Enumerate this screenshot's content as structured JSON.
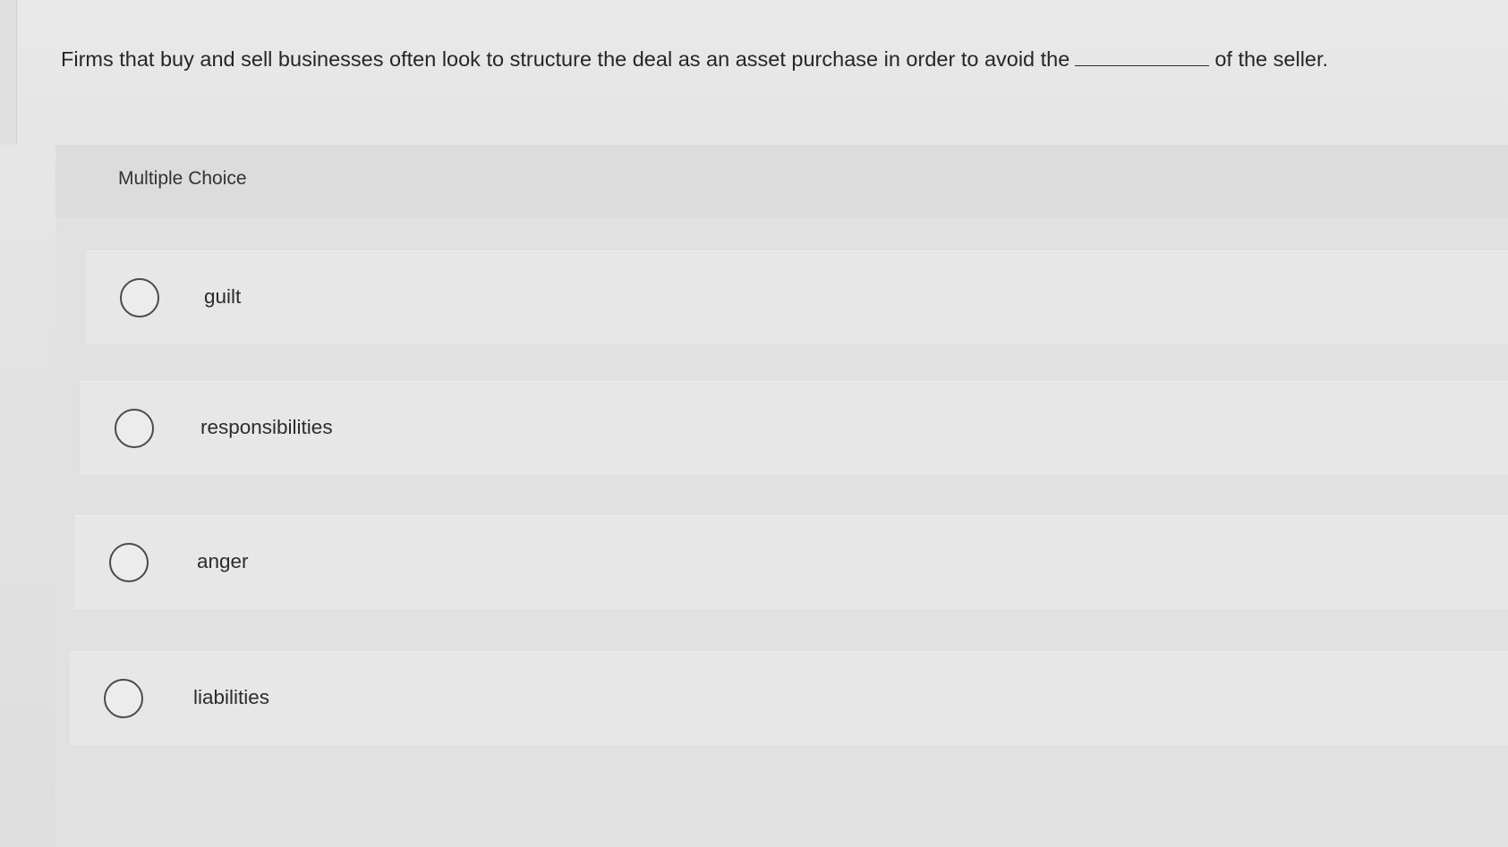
{
  "question": {
    "text_before": "Firms that buy and sell businesses often look to structure the deal as an asset purchase in order to avoid the",
    "text_after": "of the seller."
  },
  "multiple_choice": {
    "title": "Multiple Choice",
    "options": [
      {
        "label": "guilt",
        "selected": false
      },
      {
        "label": "responsibilities",
        "selected": false
      },
      {
        "label": "anger",
        "selected": false
      },
      {
        "label": "liabilities",
        "selected": false
      }
    ]
  }
}
